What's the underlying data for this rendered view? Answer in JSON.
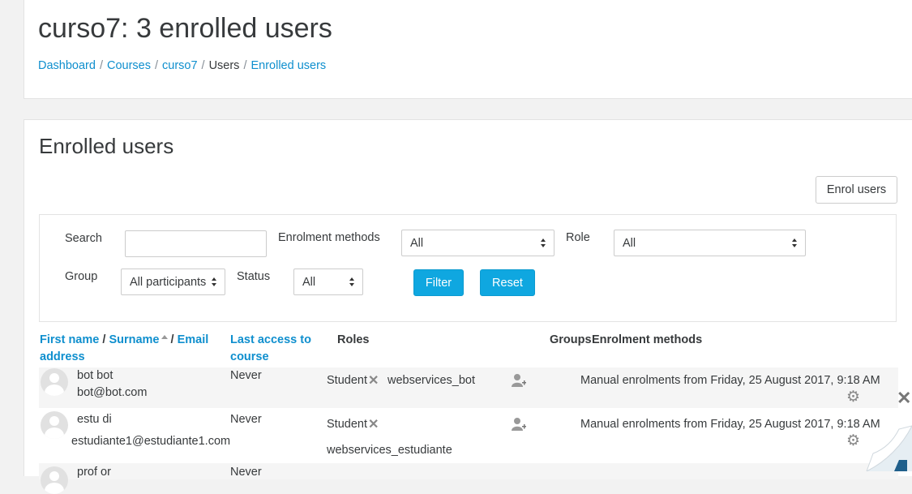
{
  "header": {
    "title": "curso7: 3 enrolled users",
    "breadcrumb": [
      "Dashboard",
      "Courses",
      "curso7",
      "Users",
      "Enrolled users"
    ],
    "breadcrumb_sep": "/"
  },
  "main": {
    "title": "Enrolled users",
    "enrol_button": "Enrol users"
  },
  "filters": {
    "search_label": "Search",
    "search_value": "",
    "enrol_methods_label": "Enrolment methods",
    "enrol_methods_value": "All",
    "role_label": "Role",
    "role_value": "All",
    "group_label": "Group",
    "group_value": "All participants",
    "status_label": "Status",
    "status_value": "All",
    "filter_button": "Filter",
    "reset_button": "Reset"
  },
  "table": {
    "headers": {
      "first_name": "First name",
      "sep": "/",
      "surname": "Surname",
      "email": "Email address",
      "last_access": "Last access to course",
      "roles": "Roles",
      "groups": "Groups",
      "enrolment_methods": "Enrolment methods"
    },
    "rows": [
      {
        "name": "bot bot",
        "email": "bot@bot.com",
        "last_access": "Never",
        "roles": [
          "Student",
          "webservices_bot"
        ],
        "enrolment": "Manual enrolments from Friday, 25 August 2017, 9:18 AM"
      },
      {
        "name": "estu di",
        "email": "estudiante1@estudiante1.com",
        "last_access": "Never",
        "roles": [
          "Student",
          "webservices_estudiante"
        ],
        "enrolment": "Manual enrolments from Friday, 25 August 2017, 9:18 AM"
      },
      {
        "name": "prof or",
        "last_access": "Never"
      }
    ]
  },
  "icons": {
    "remove": "close-icon",
    "settings": "gear-icon",
    "add_group": "add-group-icon"
  },
  "colors": {
    "link": "#0f8fce",
    "primary_button": "#0fa7e0",
    "page_background": "#f2f2f2"
  }
}
